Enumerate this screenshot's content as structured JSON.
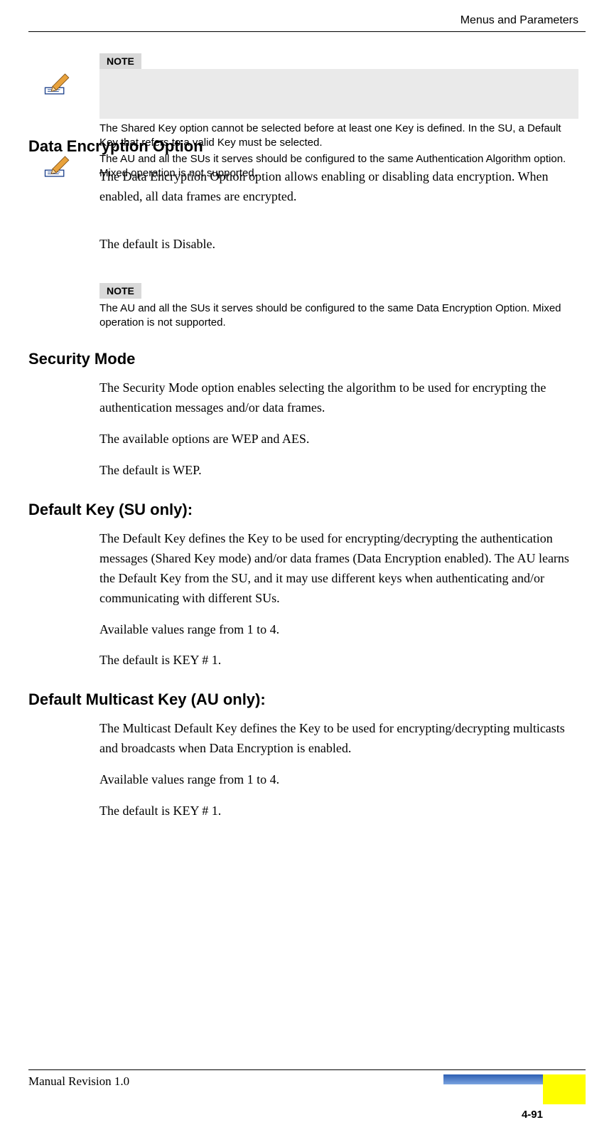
{
  "header": {
    "right_text": "Menus and Parameters"
  },
  "note1": {
    "label": "NOTE",
    "line1": "The Shared Key option cannot be selected before at least one Key is defined. In the SU, a Default Key that refers to a valid Key must be selected.",
    "line2": "The AU and all the SUs it serves should be configured to the same Authentication Algorithm option. Mixed operation is not supported."
  },
  "overlay": {
    "heading": "Data Encryption Option",
    "para1": "The Data Encryption Option option allows enabling or disabling data encryption. When enabled, all data frames are encrypted.",
    "para2": "The default is Disable."
  },
  "note2": {
    "label": "NOTE",
    "text": "The AU and all the SUs it serves should be configured to the same Data Encryption Option. Mixed operation is not supported."
  },
  "sections": [
    {
      "heading": "Security Mode",
      "paras": [
        "The Security Mode option enables selecting the algorithm to be used for encrypting the authentication messages and/or data frames.",
        "The available options are WEP and AES.",
        "The default is WEP."
      ]
    },
    {
      "heading": "Default Key (SU only):",
      "paras": [
        "The Default Key defines the Key to be used for encrypting/decrypting the authentication messages (Shared Key mode) and/or data frames (Data Encryption enabled). The AU learns the Default Key from the SU, and it may use different keys when authenticating and/or communicating with different SUs.",
        "Available values range from 1 to 4.",
        "The default is KEY # 1."
      ]
    },
    {
      "heading": "Default Multicast Key (AU only):",
      "paras": [
        "The Multicast Default Key defines the Key to be used for encrypting/decrypting multicasts and broadcasts when Data Encryption is enabled.",
        "Available values range from 1 to 4.",
        "The default is KEY # 1."
      ]
    }
  ],
  "footer": {
    "left": "Manual Revision 1.0",
    "page": "4-91"
  }
}
